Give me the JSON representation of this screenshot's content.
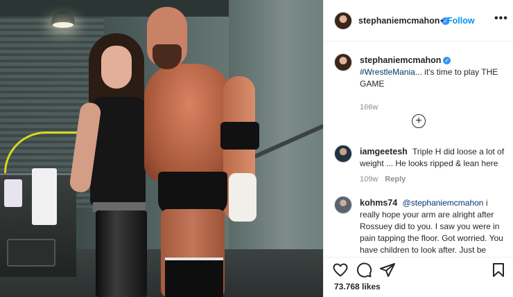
{
  "post": {
    "username": "stephaniemcmahon",
    "follow_label": "Follow",
    "separator": "•",
    "more_label": "•••",
    "caption": {
      "username": "stephaniemcmahon",
      "hashtag": "#WrestleMania",
      "text": "... it's time to play THE GAME",
      "age": "166w"
    },
    "load_more_label": "+",
    "comments": [
      {
        "username": "iamgeetesh",
        "text": "Triple H did loose a lot of weight ... He looks ripped & lean here",
        "age": "109w",
        "reply_label": "Reply"
      },
      {
        "username": "kohms74",
        "mention": "@stephaniemcmahon",
        "text": "i really hope your arm are alright after Rossuey did to you. I saw you were in pain tapping the floor. Got worried. You have children to look after. Just be careful if you need to fight in the ring."
      }
    ],
    "likes": "73.768 likes",
    "icons": {
      "like": "heart-icon",
      "comment": "comment-icon",
      "share": "share-icon",
      "save": "bookmark-icon",
      "verified": "verified-badge-icon"
    },
    "colors": {
      "link": "#0095f6",
      "hashtag": "#00376b",
      "muted": "#8e8e8e",
      "verified": "#3897f0"
    }
  }
}
